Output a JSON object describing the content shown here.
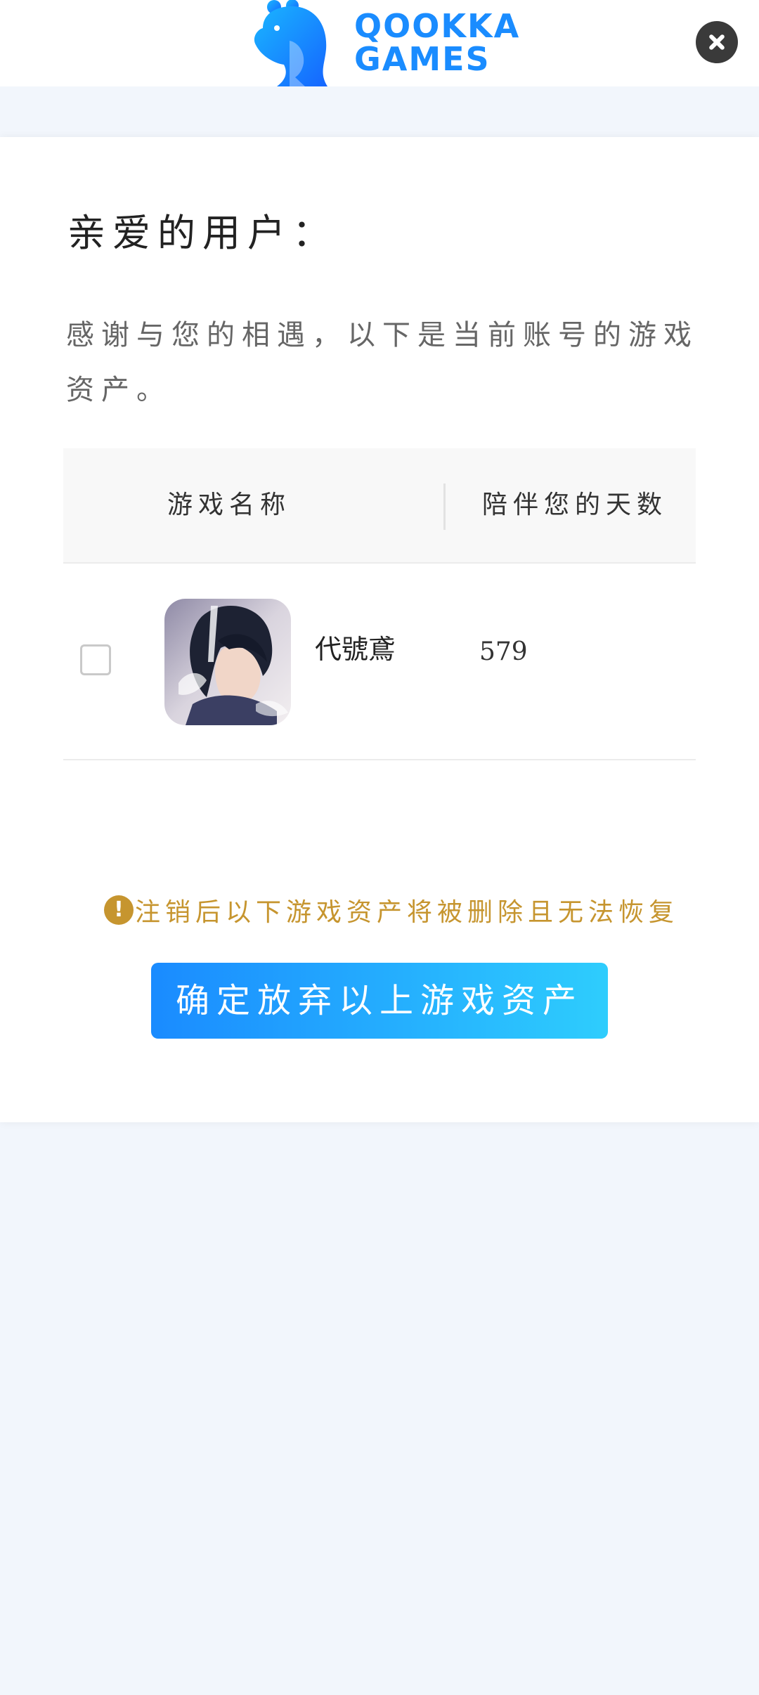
{
  "header": {
    "logo_line1": "QOOKKA",
    "logo_line2": "GAMES"
  },
  "colors": {
    "brand_blue": "#1a8cff",
    "button_gradient_start": "#1a8bff",
    "button_gradient_end": "#2ecdfd",
    "warning_gold": "#c6952f",
    "page_background": "#f2f6fc"
  },
  "icons": {
    "logo": "qookka-mascot-logo",
    "close": "close-icon",
    "warning": "exclamation-circle-icon"
  },
  "greeting": "亲爱的用户：",
  "intro": "感谢与您的相遇，以下是当前账号的游戏资产。",
  "table": {
    "headers": {
      "name": "游戏名称",
      "days": "陪伴您的天数"
    },
    "rows": [
      {
        "checked": false,
        "name": "代號鳶",
        "days": "579"
      }
    ]
  },
  "warning": {
    "icon_symbol": "!",
    "text": "注销后以下游戏资产将被删除且无法恢复"
  },
  "confirm_button": "确定放弃以上游戏资产"
}
